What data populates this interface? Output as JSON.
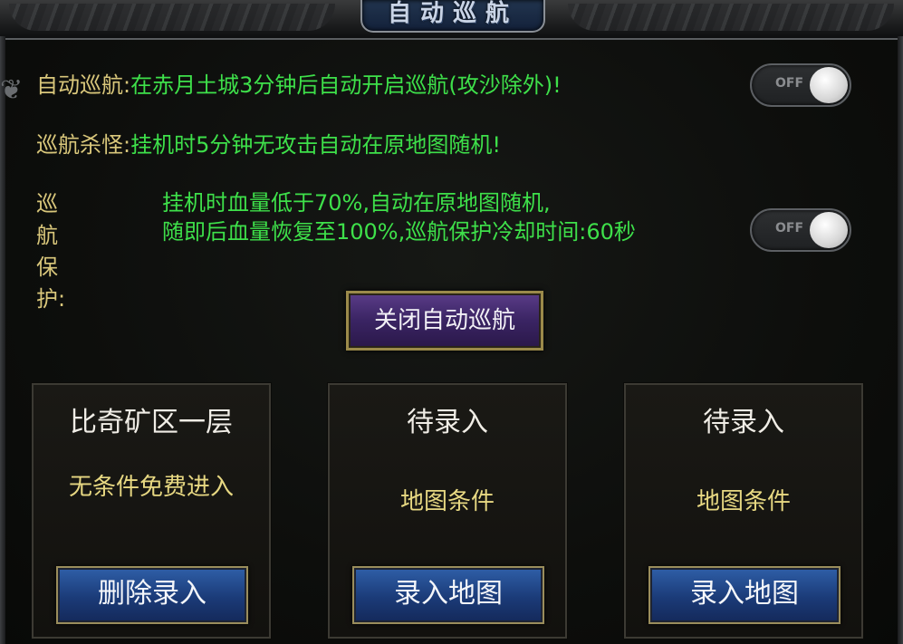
{
  "window": {
    "title": "自动巡航"
  },
  "settings": {
    "auto_cruise": {
      "label": "自动巡航:",
      "desc": "在赤月土城3分钟后自动开启巡航(攻沙除外)!",
      "toggle": "OFF"
    },
    "cruise_kill": {
      "label": "巡航杀怪:",
      "desc": "挂机时5分钟无攻击自动在原地图随机!"
    },
    "cruise_protect": {
      "label": "巡航保护:",
      "line1": "挂机时血量低于70%,自动在原地图随机,",
      "line2": "随即后血量恢复至100%,巡航保护冷却时间:60秒",
      "toggle": "OFF"
    }
  },
  "close_button": "关闭自动巡航",
  "slots": [
    {
      "title": "比奇矿区一层",
      "subtitle": "无条件免费进入",
      "button": "删除录入"
    },
    {
      "title": "待录入",
      "subtitle": "地图条件",
      "button": "录入地图"
    },
    {
      "title": "待录入",
      "subtitle": "地图条件",
      "button": "录入地图"
    }
  ],
  "colors": {
    "label": "#d9c77b",
    "highlight": "#3ee04a",
    "close_button": "#3a2463",
    "slot_button": "#1b3b78"
  }
}
